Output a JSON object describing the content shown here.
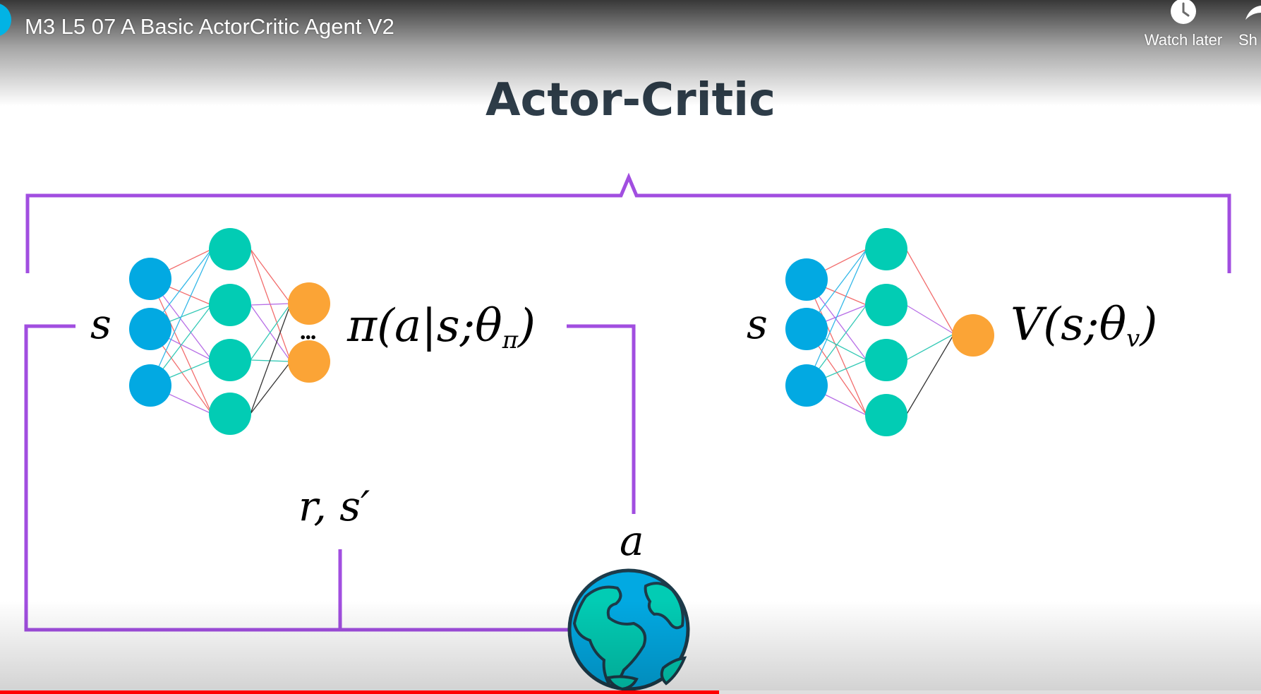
{
  "player": {
    "video_title": "M3 L5 07 A Basic ActorCritic Agent V2",
    "watch_later_label": "Watch later",
    "share_label": "Sh",
    "progress_fraction": 0.57
  },
  "slide": {
    "title": "Actor-Critic",
    "actor": {
      "input_label": "s",
      "output_label_main": "π(a|s;θ",
      "output_label_sub": "π",
      "output_label_close": ")",
      "ellipsis": "..."
    },
    "critic": {
      "input_label": "s",
      "output_label_main": "V(s;θ",
      "output_label_sub": "v",
      "output_label_close": ")"
    },
    "feedback_label": "r, s′",
    "action_label": "a"
  },
  "colors": {
    "bracket": "#a14ee0",
    "input_node": "#02a9e2",
    "hidden_node": "#02ccb4",
    "output_node": "#fba436",
    "title_text": "#2e3d49",
    "progress": "#ff0000",
    "globe_ocean": "#02a9e2",
    "globe_land": "#02ccb4"
  }
}
